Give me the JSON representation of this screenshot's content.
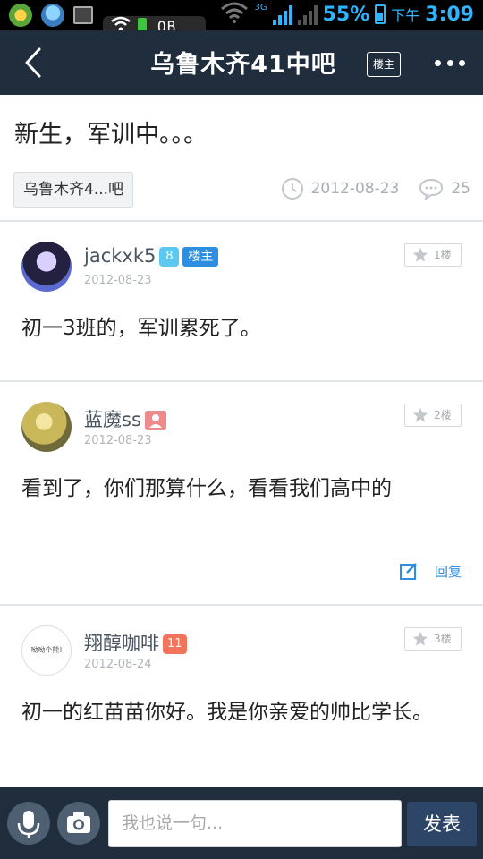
{
  "status_bar": {
    "network": "3G",
    "battery_percent": "55%",
    "am_pm": "下午",
    "time": "3:09",
    "notification_text": "OB"
  },
  "header": {
    "title": "乌鲁木齐41中吧",
    "owner_badge": "楼主"
  },
  "thread": {
    "title": "新生，军训中。。。",
    "forum_chip": "乌鲁木齐4...吧",
    "date": "2012-08-23",
    "reply_count": "25"
  },
  "replies": [
    {
      "username": "jackxk5",
      "level": "8",
      "owner_tag": "楼主",
      "date": "2012-08-23",
      "floor": "1楼",
      "text": "初一3班的，军训累死了。"
    },
    {
      "username": "蓝魔ss",
      "date": "2012-08-23",
      "floor": "2楼",
      "text": "看到了，你们那算什么，看看我们高中的",
      "reply_label": "回复"
    },
    {
      "username": "翔醇咖啡",
      "level": "11",
      "date": "2012-08-24",
      "floor": "3楼",
      "text": "初一的红苗苗你好。我是你亲爱的帅比学长。",
      "avatar_text": "呦呦个熊!"
    }
  ],
  "bottom_bar": {
    "input_placeholder": "我也说一句...",
    "send_label": "发表"
  },
  "colors": {
    "header_bg": "#1f2d3d",
    "accent_blue": "#2e8ee0",
    "status_blue": "#2fb4ff",
    "send_button": "#2d4566"
  }
}
